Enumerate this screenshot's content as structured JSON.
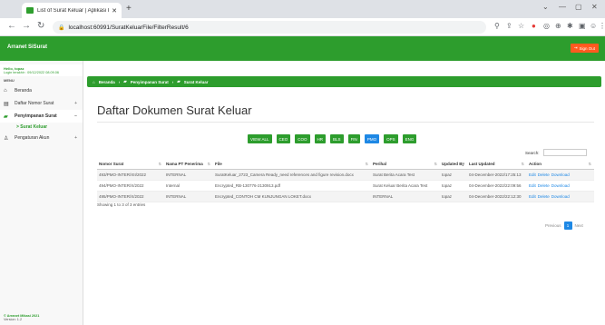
{
  "browser": {
    "tab_title": "List of Surat Keluar | Aplikasi Pen",
    "url": "localhost:60991/SuratKeluarFile/FilterResult/6"
  },
  "app": {
    "brand": "Arranet SiSurat",
    "sign_out": "Sign Out"
  },
  "user": {
    "hello": "Hello, topaz",
    "last_login": "Login terakhir : 09/12/2022 08.09.06"
  },
  "sidebar": {
    "menu_title": "MENU",
    "items": [
      {
        "label": "Beranda"
      },
      {
        "label": "Daftar Nomor Surat"
      },
      {
        "label": "Penyimpanan Surat"
      },
      {
        "label": "Pengaturan Akun"
      }
    ],
    "sub_item": "> Surat Keluar",
    "footer_brand": "© Arranet Mikasi 2021",
    "footer_version": "Version: 1.2"
  },
  "breadcrumb": [
    "Beranda",
    "Penyimpanan Surat",
    "Surat Keluar"
  ],
  "page": {
    "title": "Daftar Dokumen Surat Keluar"
  },
  "filters": [
    "VIEW ALL",
    "CEO",
    "COO",
    "HR",
    "BLS",
    "FIN",
    "PMO",
    "OPS",
    "ENG"
  ],
  "search": {
    "label": "Search:"
  },
  "table": {
    "headers": [
      "Nomor Surat",
      "Nama PT Penerima",
      "File",
      "Perihal",
      "Updated By",
      "Last Updated",
      "Action"
    ],
    "rows": [
      [
        "493/PMO-INTER/XII/2022",
        "INTERNAL",
        "SuratKeluar_2723_Camera Ready_need references and figure revision.docx",
        "Surat Berita Acara Test",
        "topaz",
        "04-December-2022/17:25:13"
      ],
      [
        "494/PMO-INTER/X/2022",
        "Internal",
        "Encrypted_RB-130776-2130913.pdf",
        "Surat Keluar Berita Acara Test",
        "topaz",
        "04-December-2022/22:09:56"
      ],
      [
        "495/PMO-INTER/X/2022",
        "INTERNAL",
        "Encrypted_CONTOH CM KUNJUNGAN LOKET.docx",
        "INTERNAL",
        "topaz",
        "04-December-2022/22:12:30"
      ]
    ],
    "actions": [
      "Edit",
      "Delete",
      "Download"
    ]
  },
  "table_info": "Showing 1 to 3 of 3 entries",
  "pager": {
    "previous": "Previous",
    "page": "1",
    "next": "Next"
  }
}
